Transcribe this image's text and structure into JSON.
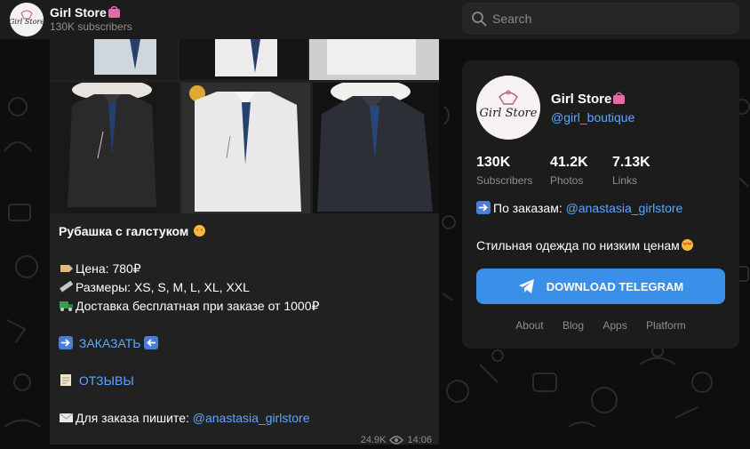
{
  "header": {
    "title": "Girl Store",
    "subscribers": "130K subscribers",
    "search_placeholder": "Search"
  },
  "post": {
    "title": "Рубашка с галстуком",
    "price": "Цена: 780₽",
    "sizes": "Размеры: XS, S, M, L, XL, XXL",
    "delivery": "Доставка бесплатная при заказе от 1000₽",
    "order_link": "ЗАКАЗАТЬ",
    "reviews_link": "ОТЗЫВЫ",
    "contact_prefix": "Для заказа пишите: ",
    "contact_link": "@anastasia_girlstore",
    "views": "24.9K",
    "time": "14:06"
  },
  "card": {
    "title": "Girl Store",
    "handle": "@girl_boutique",
    "stats": [
      {
        "num": "130K",
        "label": "Subscribers"
      },
      {
        "num": "41.2K",
        "label": "Photos"
      },
      {
        "num": "7.13K",
        "label": "Links"
      }
    ],
    "orders_prefix": "По заказам: ",
    "orders_link": "@anastasia_girlstore",
    "tagline": "Стильная одежда по низким ценам",
    "download_label": "DOWNLOAD TELEGRAM",
    "footer": [
      "About",
      "Blog",
      "Apps",
      "Platform"
    ]
  },
  "logo_text": "Girl Store",
  "colors": {
    "accent": "#3a8fe8",
    "link": "#5ea6ff",
    "background": "#0e0e0e"
  }
}
